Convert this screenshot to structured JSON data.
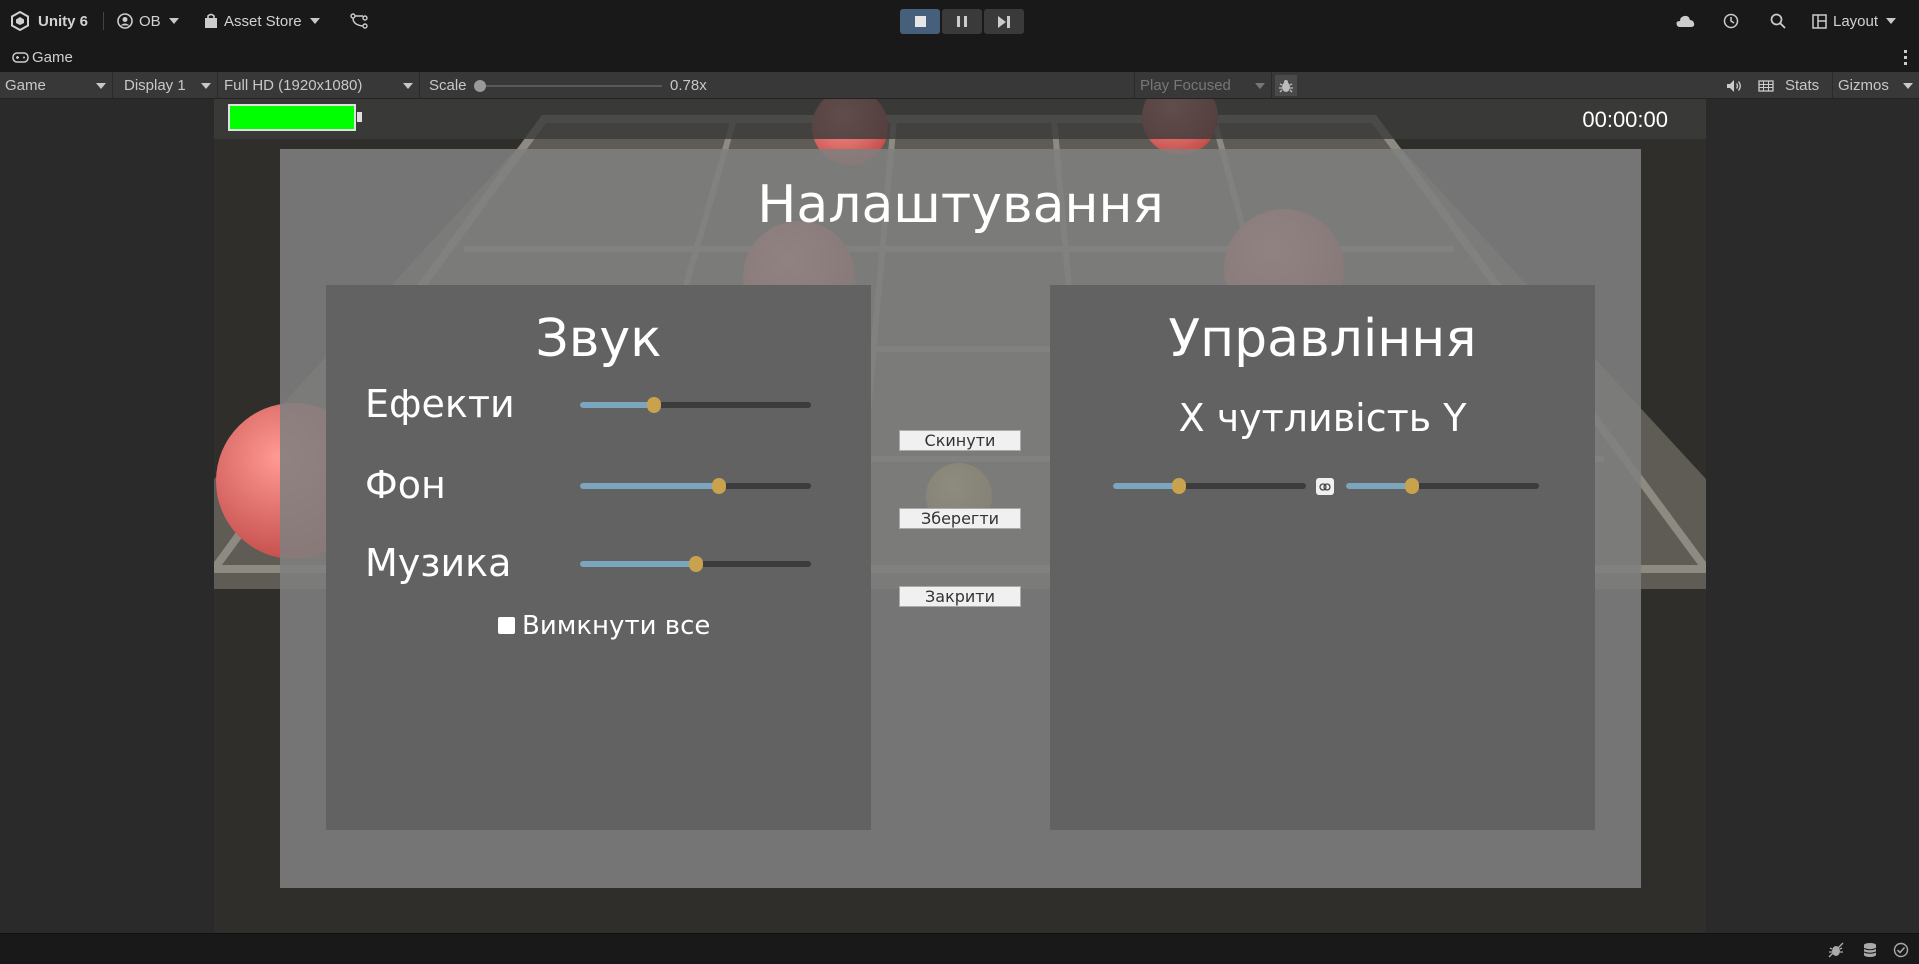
{
  "topbar": {
    "app_title": "Unity 6",
    "account": "OB",
    "asset_store": "Asset Store",
    "layout": "Layout"
  },
  "tabs": {
    "game_tab": "Game"
  },
  "toolbar": {
    "view_mode": "Game",
    "display": "Display 1",
    "resolution": "Full HD (1920x1080)",
    "scale_label": "Scale",
    "scale_value": "0.78x",
    "play_focused": "Play Focused",
    "stats": "Stats",
    "gizmos": "Gizmos"
  },
  "hud": {
    "timer": "00:00:00",
    "health_fraction": 1.0,
    "health_color": "#00ff00"
  },
  "settings": {
    "title": "Налаштування",
    "sound": {
      "title": "Звук",
      "effects_label": "Ефекти",
      "effects_value": 0.32,
      "background_label": "Фон",
      "background_value": 0.6,
      "music_label": "Музика",
      "music_value": 0.5,
      "mute_all_label": "Вимкнути все",
      "mute_all_checked": false
    },
    "buttons": {
      "reset": "Скинути",
      "save": "Зберегти",
      "close": "Закрити"
    },
    "controls": {
      "title": "Управління",
      "sensitivity_label": "X чутливість Y",
      "sens_x_value": 0.34,
      "sens_y_value": 0.34
    }
  },
  "colors": {
    "slider_fill": "#7ba6bd",
    "slider_knob": "#c8a24d",
    "play_active": "#46607c"
  }
}
